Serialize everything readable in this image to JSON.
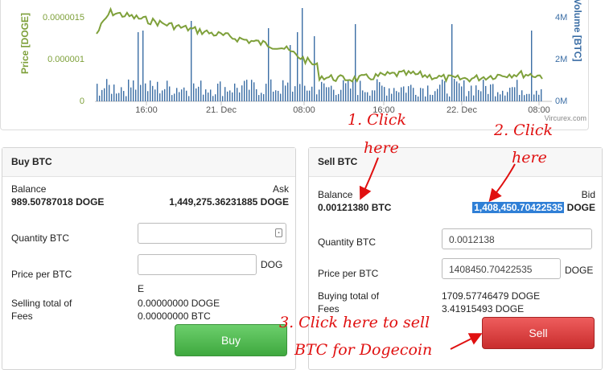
{
  "chart": {
    "y_left_label": "Price [DOGE]",
    "y_right_label": "Volume [BTC]",
    "y_left_ticks": [
      "0.0000015",
      "0.000001",
      "0"
    ],
    "y_right_ticks": [
      "4M",
      "2M",
      "0M"
    ],
    "x_ticks": [
      "16:00",
      "21. Dec",
      "08:00",
      "16:00",
      "22. Dec",
      "08:00"
    ],
    "credit": "Vircurex.com",
    "colors": {
      "price": "#7ea03a",
      "volume": "#3b6ea5"
    }
  },
  "buy": {
    "title": "Buy BTC",
    "balance_label": "Balance",
    "balance_value": "989.50787018 DOGE",
    "ask_label": "Ask",
    "ask_value": "1,449,275.36231885 DOGE",
    "quantity_label": "Quantity BTC",
    "quantity_value": "",
    "price_label": "Price per BTC",
    "price_value": "",
    "price_unit_a": "DOG",
    "price_unit_b": "E",
    "total_label": "Selling total of",
    "total_value": "0.00000000 DOGE",
    "fees_label": "Fees",
    "fees_value": "0.00000000 BTC",
    "button": "Buy"
  },
  "sell": {
    "title": "Sell BTC",
    "balance_label": "Balance",
    "balance_value": "0.00121380 BTC",
    "bid_label": "Bid",
    "bid_value": "1,408,450.70422535",
    "bid_unit": "DOGE",
    "quantity_label": "Quantity BTC",
    "quantity_value": "0.0012138",
    "price_label": "Price per BTC",
    "price_value": "1408450.70422535",
    "price_unit": "DOGE",
    "total_label": "Buying total of",
    "total_value": "1709.57746479 DOGE",
    "fees_label": "Fees",
    "fees_value": "3.41915493 DOGE",
    "button": "Sell"
  },
  "annotations": {
    "step1a": "1. Click",
    "step1b": "here",
    "step2a": "2. Click",
    "step2b": "here",
    "step3a": "3. Click here to sell",
    "step3b": "BTC for Dogecoin",
    "color": "#e01010"
  }
}
